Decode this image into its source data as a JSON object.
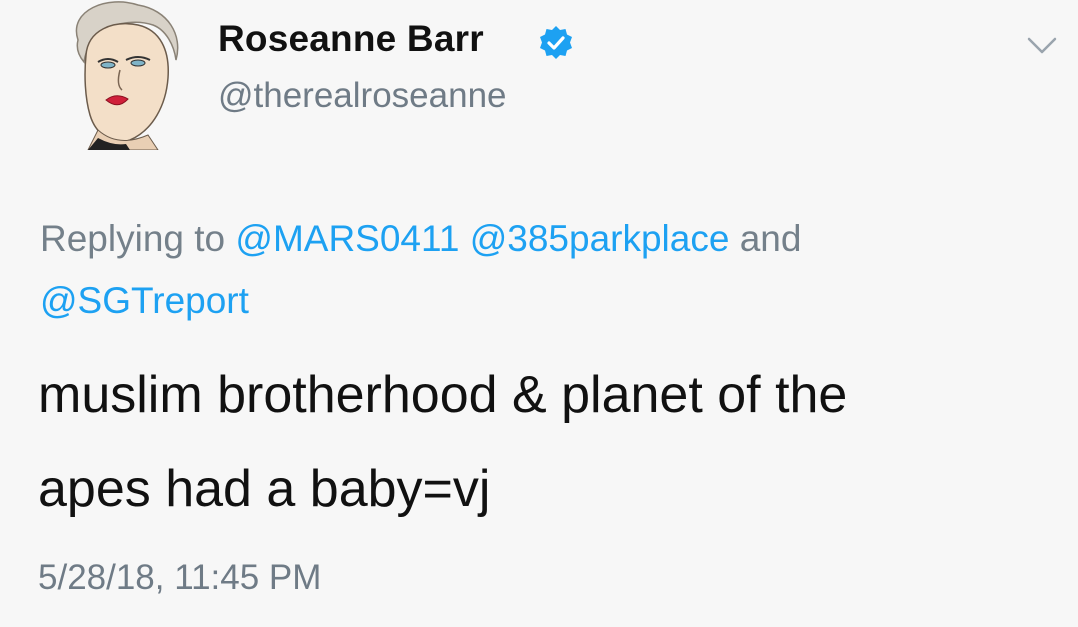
{
  "author": {
    "display_name": "Roseanne Barr",
    "handle": "@therealroseanne",
    "verified": true,
    "avatar_icon": "profile-drawing-avatar"
  },
  "reply": {
    "prefix": "Replying to",
    "mentions": [
      "@MARS0411",
      "@385parkplace",
      "@SGTreport"
    ],
    "conjunction": "and"
  },
  "tweet": {
    "line1": "muslim brotherhood & planet of the",
    "line2": "apes had a baby=vj"
  },
  "timestamp": "5/28/18, 11:45 PM",
  "icons": {
    "verified": "verified-badge-icon",
    "menu": "chevron-down-icon"
  },
  "colors": {
    "mention": "#1da1f2",
    "verified": "#1da1f2",
    "secondary_text": "#6f7b86",
    "primary_text": "#111111"
  }
}
